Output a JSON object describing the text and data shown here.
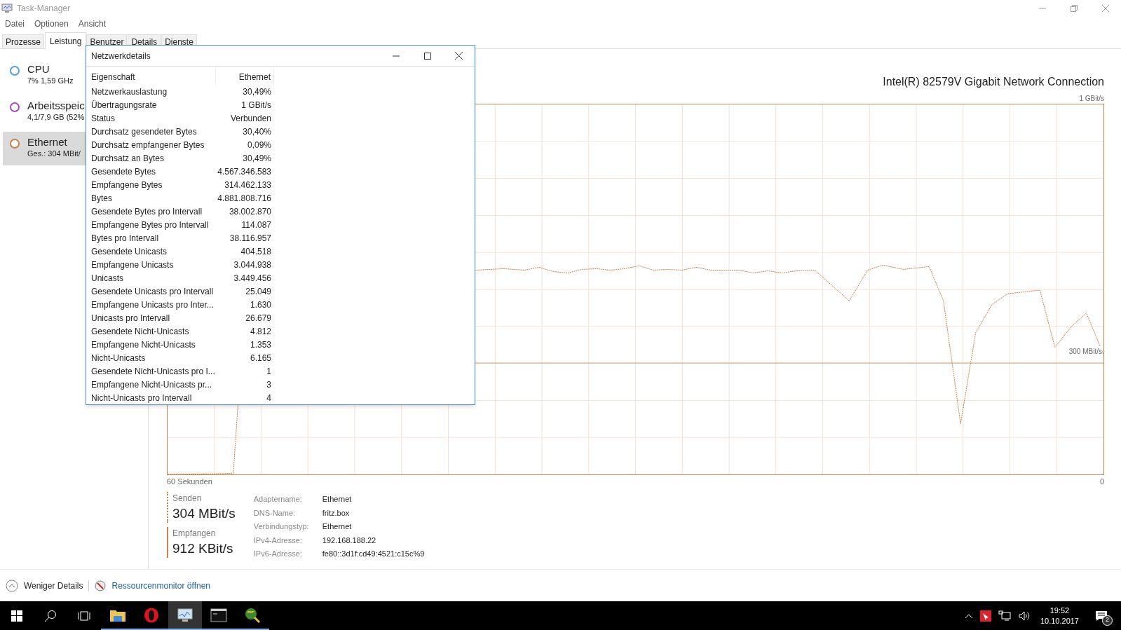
{
  "window": {
    "title": "Task-Manager"
  },
  "menu": [
    "Datei",
    "Optionen",
    "Ansicht"
  ],
  "tabs": [
    {
      "label": "Prozesse",
      "selected": false
    },
    {
      "label": "Leistung",
      "selected": true
    },
    {
      "label": "Benutzer",
      "selected": false
    },
    {
      "label": "Details",
      "selected": false
    },
    {
      "label": "Dienste",
      "selected": false
    }
  ],
  "sidebar": {
    "items": [
      {
        "name": "CPU",
        "detail": "7%  1,59 GHz",
        "color": "#4fa3d9",
        "selected": false
      },
      {
        "name": "Arbeitsspeic",
        "detail": "4,1/7,9 GB (52%",
        "color": "#a64dc0",
        "selected": false
      },
      {
        "name": "Ethernet",
        "detail": "Ges.: 304 MBit/",
        "color": "#c8814a",
        "selected": true
      }
    ]
  },
  "adapter_title": "Intel(R) 82579V Gigabit Network Connection",
  "chart": {
    "top_label": "1 GBit/s",
    "marker_label": "300 MBit/s",
    "x_start_label": "60 Sekunden",
    "x_end_label": "0"
  },
  "stats": [
    {
      "kind": "send",
      "label": "Senden",
      "value": "304 MBit/s"
    },
    {
      "kind": "receive",
      "label": "Empfangen",
      "value": "912 KBit/s"
    }
  ],
  "details": [
    {
      "label": "Adaptername:",
      "value": "Ethernet"
    },
    {
      "label": "DNS-Name:",
      "value": "fritz.box"
    },
    {
      "label": "Verbindungstyp:",
      "value": "Ethernet"
    },
    {
      "label": "IPv4-Adresse:",
      "value": "192.168.188.22"
    },
    {
      "label": "IPv6-Adresse:",
      "value": "fe80::3d1f:cd49:4521:c15c%9"
    }
  ],
  "footer": {
    "less_details": "Weniger Details",
    "resource_monitor": "Ressourcenmonitor öffnen"
  },
  "dialog": {
    "title": "Netzwerkdetails",
    "columns": [
      "Eigenschaft",
      "Ethernet"
    ],
    "rows": [
      {
        "property": "Netzwerkauslastung",
        "value": "30,49%"
      },
      {
        "property": "Übertragungsrate",
        "value": "1 GBit/s"
      },
      {
        "property": "Status",
        "value": "Verbunden"
      },
      {
        "property": "Durchsatz gesendeter Bytes",
        "value": "30,40%"
      },
      {
        "property": "Durchsatz empfangener Bytes",
        "value": "0,09%"
      },
      {
        "property": "Durchsatz an Bytes",
        "value": "30,49%"
      },
      {
        "property": "Gesendete Bytes",
        "value": "4.567.346.583"
      },
      {
        "property": "Empfangene Bytes",
        "value": "314.462.133"
      },
      {
        "property": "Bytes",
        "value": "4.881.808.716"
      },
      {
        "property": "Gesendete Bytes pro Intervall",
        "value": "38.002.870"
      },
      {
        "property": "Empfangene Bytes pro Intervall",
        "value": "114.087"
      },
      {
        "property": "Bytes pro Intervall",
        "value": "38.116.957"
      },
      {
        "property": "Gesendete Unicasts",
        "value": "404.518"
      },
      {
        "property": "Empfangene Unicasts",
        "value": "3.044.938"
      },
      {
        "property": "Unicasts",
        "value": "3.449.456"
      },
      {
        "property": "Gesendete Unicasts pro Intervall",
        "value": "25.049"
      },
      {
        "property": "Empfangene Unicasts pro Inter...",
        "value": "1.630"
      },
      {
        "property": "Unicasts pro Intervall",
        "value": "26.679"
      },
      {
        "property": "Gesendete Nicht-Unicasts",
        "value": "4.812"
      },
      {
        "property": "Empfangene Nicht-Unicasts",
        "value": "1.353"
      },
      {
        "property": "Nicht-Unicasts",
        "value": "6.165"
      },
      {
        "property": "Gesendete Nicht-Unicasts pro I...",
        "value": "1"
      },
      {
        "property": "Empfangene Nicht-Unicasts pr...",
        "value": "3"
      },
      {
        "property": "Nicht-Unicasts pro Intervall",
        "value": "4"
      }
    ]
  },
  "taskbar": {
    "apps": [
      {
        "kind": "explorer",
        "running": true,
        "active": false
      },
      {
        "kind": "opera",
        "running": true,
        "active": false
      },
      {
        "kind": "taskmanager",
        "running": true,
        "active": true
      },
      {
        "kind": "console",
        "running": true,
        "active": false
      },
      {
        "kind": "globe",
        "running": true,
        "active": false
      }
    ],
    "tray": {
      "time": "19:52",
      "date": "10.10.2017",
      "notifications": "2"
    }
  }
}
